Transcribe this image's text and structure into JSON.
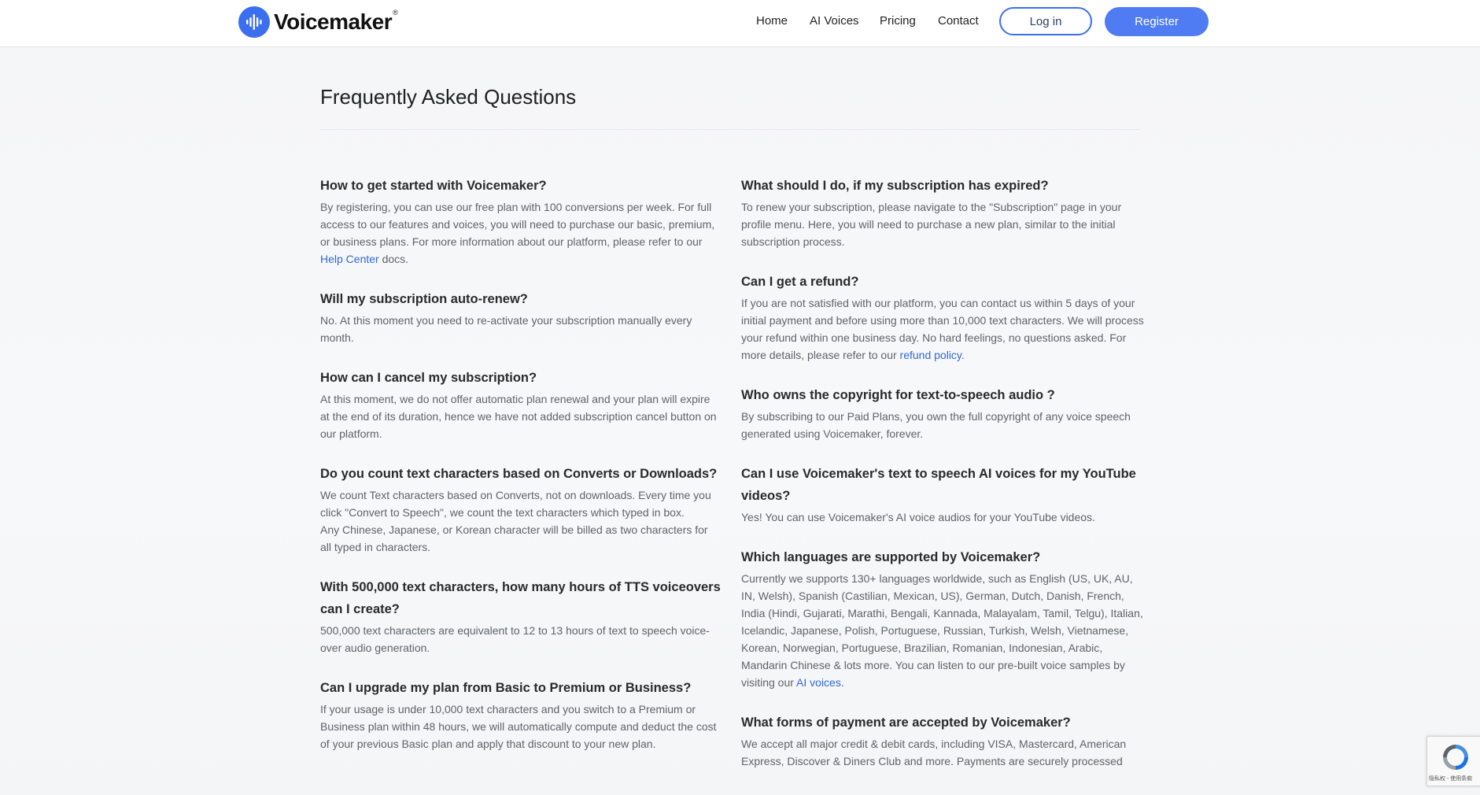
{
  "brand": {
    "name": "Voicemaker",
    "reg_mark": "®",
    "accent": "#3c6ff0"
  },
  "nav": {
    "home": "Home",
    "ai_voices": "AI Voices",
    "pricing": "Pricing",
    "contact": "Contact",
    "login": "Log in",
    "register": "Register"
  },
  "page": {
    "title": "Frequently Asked Questions"
  },
  "faq_left": [
    {
      "q": "How to get started with Voicemaker?",
      "a_before": "By registering, you can use our free plan with 100 conversions per week. For full access to our features and voices, you will need to purchase our basic, premium, or business plans. For more information about our platform, please refer to our ",
      "link": "Help Center",
      "a_after": " docs."
    },
    {
      "q": "Will my subscription auto-renew?",
      "a": "No. At this moment you need to re-activate your subscription manually every month."
    },
    {
      "q": "How can I cancel my subscription?",
      "a": "At this moment, we do not offer automatic plan renewal and your plan will expire at the end of its duration, hence we have not added subscription cancel button on our platform."
    },
    {
      "q": "Do you count text characters based on Converts or Downloads?",
      "a": "We count Text characters based on Converts, not on downloads. Every time you click \"Convert to Speech\", we count the text characters which typed in box.",
      "a2": "Any Chinese, Japanese, or Korean character will be billed as two characters for all typed in characters."
    },
    {
      "q": "With 500,000 text characters, how many hours of TTS voiceovers can I create?",
      "a": "500,000 text characters are equivalent to 12 to 13 hours of text to speech voice-over audio generation."
    },
    {
      "q": "Can I upgrade my plan from Basic to Premium or Business?",
      "a": "If your usage is under 10,000 text characters and you switch to a Premium or Business plan within 48 hours, we will automatically compute and deduct the cost of your previous Basic plan and apply that discount to your new plan."
    }
  ],
  "faq_right": [
    {
      "q": "What should I do, if my subscription has expired?",
      "a": "To renew your subscription, please navigate to the \"Subscription\" page in your profile menu. Here, you will need to purchase a new plan, similar to the initial subscription process."
    },
    {
      "q": "Can I get a refund?",
      "a_before": "If you are not satisfied with our platform, you can contact us within 5 days of your initial payment and before using more than 10,000 text characters. We will process your refund within one business day. No hard feelings, no questions asked. For more details, please refer to our ",
      "link": "refund policy",
      "a_after": "."
    },
    {
      "q": "Who owns the copyright for text-to-speech audio ?",
      "a": "By subscribing to our Paid Plans, you own the full copyright of any voice speech generated using Voicemaker, forever."
    },
    {
      "q": "Can I use Voicemaker's text to speech AI voices for my YouTube videos?",
      "a": "Yes! You can use Voicemaker's AI voice audios for your YouTube videos."
    },
    {
      "q": "Which languages are supported by Voicemaker?",
      "a_before": "Currently we supports 130+ languages worldwide, such as English (US, UK, AU, IN, Welsh), Spanish (Castilian, Mexican, US), German, Dutch, Danish, French, India (Hindi, Gujarati, Marathi, Bengali, Kannada, Malayalam, Tamil, Telgu), Italian, Icelandic, Japanese, Polish, Portuguese, Russian, Turkish, Welsh, Vietnamese, Korean, Norwegian, Portuguese, Brazilian, Romanian, Indonesian, Arabic, Mandarin Chinese & lots more. You can listen to our pre-built voice samples by visiting our ",
      "link": "AI voices",
      "a_after": "."
    },
    {
      "q": "What forms of payment are accepted by Voicemaker?",
      "a": "We accept all major credit & debit cards, including VISA, Mastercard, American Express, Discover & Diners Club and more. Payments are securely processed"
    }
  ],
  "recaptcha": {
    "label": "隐私权 - 使用条款"
  }
}
